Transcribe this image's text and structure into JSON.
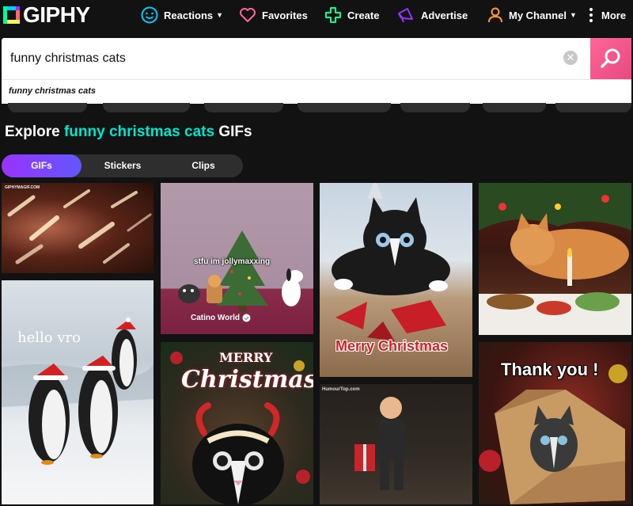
{
  "brand": {
    "logo_text": "GIPHY"
  },
  "nav": {
    "reactions": "Reactions",
    "favorites": "Favorites",
    "create": "Create",
    "advertise": "Advertise",
    "my_channel": "My Channel",
    "more": "More"
  },
  "search": {
    "value": "funny christmas cats",
    "suggestion": "funny christmas cats"
  },
  "heading": {
    "prefix": "Explore ",
    "highlight": "funny christmas cats",
    "suffix": " GIFs"
  },
  "tabs": [
    {
      "label": "GIFs",
      "active": true
    },
    {
      "label": "Stickers",
      "active": false
    },
    {
      "label": "Clips",
      "active": false
    }
  ],
  "gifs": {
    "gif1_watermark": "GIPHYMAGIF.COM",
    "gif2_text": "hello vro",
    "gif3_caption": "stfu im jollymaxxing",
    "gif3_channel": "Catino World",
    "gif4_text_line1": "MERRY",
    "gif4_text_line2": "Christmas",
    "gif5_caption": "Merry Christmas",
    "gif6_watermark": "HumourTop.com",
    "gif8_caption": "Thank you !"
  },
  "colors": {
    "background": "#121212",
    "accent_teal": "#00e6cc",
    "tab_active_gradient": [
      "#9933ff",
      "#6157ff"
    ],
    "search_button": "#e64980"
  }
}
